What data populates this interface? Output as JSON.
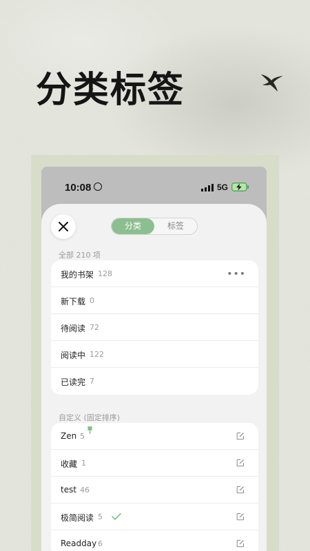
{
  "headline": "分类标签",
  "status_bar": {
    "time": "10:08",
    "network": "5G"
  },
  "tabs": [
    {
      "label": "分类",
      "active": true
    },
    {
      "label": "标签",
      "active": false
    }
  ],
  "all_section": {
    "label": "全部 210 项",
    "items": [
      {
        "label": "我的书架",
        "count": "128",
        "more_icon": "ellipsis-icon"
      },
      {
        "label": "新下载",
        "count": "0"
      },
      {
        "label": "待阅读",
        "count": "72"
      },
      {
        "label": "阅读中",
        "count": "122"
      },
      {
        "label": "已读完",
        "count": "7"
      }
    ]
  },
  "custom_section": {
    "label": "自定义 (固定排序)",
    "items": [
      {
        "label": "Zen",
        "count": "5",
        "pinned": true
      },
      {
        "label": "收藏",
        "count": "1"
      },
      {
        "label": "test",
        "count": "46"
      },
      {
        "label": "极简阅读",
        "count": "5",
        "checked": true
      },
      {
        "label": "Readday",
        "count": "6"
      }
    ]
  },
  "colors": {
    "accent": "#8cbf90",
    "sheet_bg": "#f2f2f2",
    "phone_bg": "#bdbdbd"
  }
}
